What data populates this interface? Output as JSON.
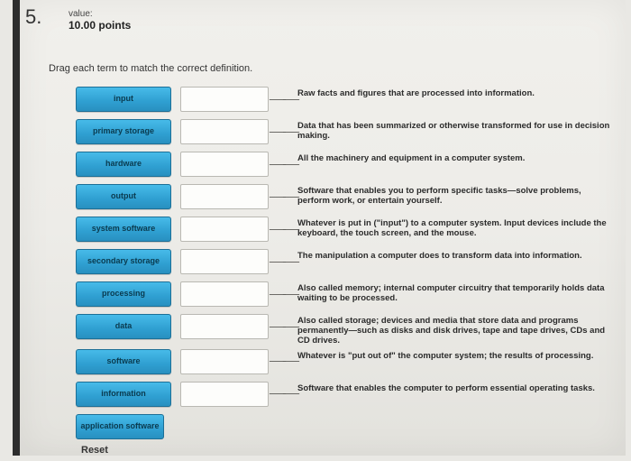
{
  "question": {
    "number": "5.",
    "value_label": "value:",
    "points": "10.00 points",
    "instructions": "Drag each term to match the correct definition."
  },
  "rows": [
    {
      "term": "input",
      "definition": "Raw facts and figures that are processed into information."
    },
    {
      "term": "primary storage",
      "definition": "Data that has been summarized or otherwise transformed for use in decision making."
    },
    {
      "term": "hardware",
      "definition": "All the machinery and equipment in a computer system."
    },
    {
      "term": "output",
      "definition": "Software that enables you to perform specific tasks—solve problems, perform work, or entertain yourself."
    },
    {
      "term": "system software",
      "definition": "Whatever is put in (\"input\") to a computer system. Input devices include the keyboard, the touch screen, and the mouse."
    },
    {
      "term": "secondary storage",
      "definition": "The manipulation a computer does to transform data into information."
    },
    {
      "term": "processing",
      "definition": "Also called memory; internal computer circuitry that temporarily holds data waiting to be processed."
    },
    {
      "term": "data",
      "definition": "Also called storage; devices and media that store data and programs permanently—such as disks and disk drives, tape and tape drives, CDs and CD drives."
    },
    {
      "term": "software",
      "definition": "Whatever is \"put out of\" the computer system; the results of processing."
    },
    {
      "term": "information",
      "definition": "Software that enables the computer to perform essential operating tasks."
    }
  ],
  "extra_term": "application software",
  "reset_label": "Reset",
  "connector_glyph": "——"
}
